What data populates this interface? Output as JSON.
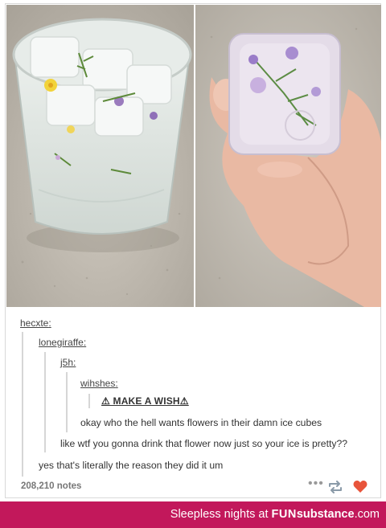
{
  "post": {
    "note_count": "208,210 notes",
    "thread": {
      "user1": "hecxte",
      "user2": "lonegiraffe",
      "user3": "j5h",
      "user4": "wihshes",
      "make_a_wish": "⚠ MAKE A WISH⚠",
      "reply4": "okay who the hell wants flowers in their damn ice cubes",
      "reply3": "like wtf you gonna drink that flower now just so your ice is pretty??",
      "reply2": "yes that's literally the reason they did it um"
    },
    "colon": ":",
    "colors": {
      "heart": "#e8543b",
      "reblog": "#8a9aa8",
      "brand_bar": "#c2185b"
    }
  },
  "watermark": {
    "caption": "Sleepless nights at ",
    "brand_fun": "FUN",
    "brand_sub": "substance",
    "brand_dom": ".com"
  },
  "icons": [
    "more-dots-icon",
    "reblog-icon",
    "heart-icon"
  ]
}
